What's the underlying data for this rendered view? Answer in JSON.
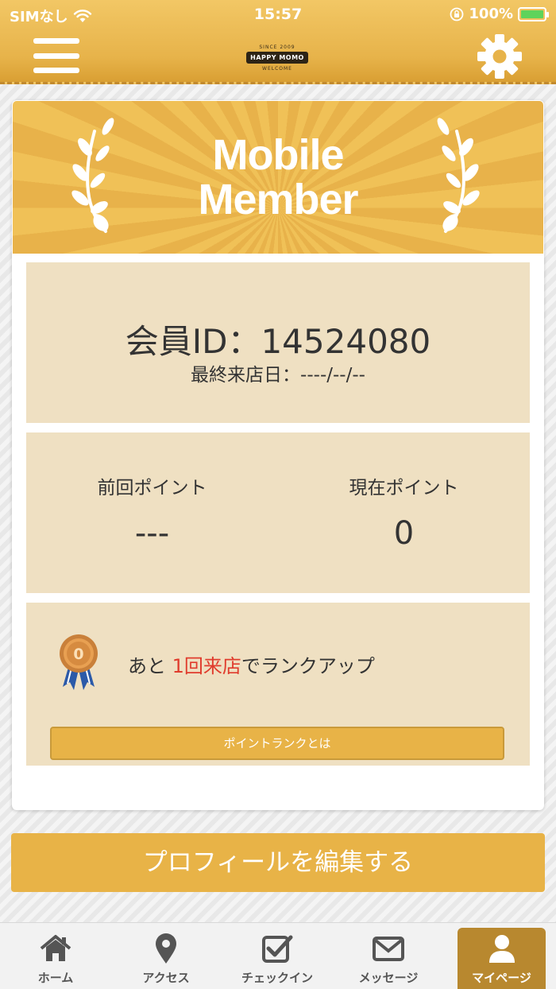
{
  "status_bar": {
    "carrier": "SIMなし",
    "time": "15:57",
    "battery": "100%",
    "icons": [
      "wifi-icon",
      "orientation-lock-icon",
      "battery-charging-icon"
    ]
  },
  "header": {
    "logo": {
      "since": "SINCE 2009",
      "name": "HAPPY MOMO",
      "welcome": "WELCOME"
    },
    "icons": [
      "hamburger-menu-icon",
      "gear-icon"
    ]
  },
  "card": {
    "banner_title_line1": "Mobile",
    "banner_title_line2": "Member",
    "member_id_text": "会員ID：14524080",
    "last_visit_text": "最終来店日：----/--/--",
    "points": {
      "previous_label": "前回ポイント",
      "previous_value": "---",
      "current_label": "現在ポイント",
      "current_value": "0"
    },
    "rank": {
      "medal_number": "0",
      "text_before": "あと ",
      "text_accent": "1回来店",
      "text_after": "でランクアップ",
      "button_label": "ポイントランクとは"
    }
  },
  "edit_profile_label": "プロフィールを編集する",
  "tabs": [
    {
      "label": "ホーム",
      "icon": "home-icon"
    },
    {
      "label": "アクセス",
      "icon": "map-pin-icon"
    },
    {
      "label": "チェックイン",
      "icon": "checkin-icon"
    },
    {
      "label": "メッセージ",
      "icon": "envelope-icon"
    },
    {
      "label": "マイページ",
      "icon": "user-icon",
      "active": true
    }
  ],
  "colors": {
    "accent_gold": "#e8b347",
    "panel_beige": "#efe0c2",
    "highlight_red": "#e03c2d",
    "active_tab": "#b8882f"
  }
}
